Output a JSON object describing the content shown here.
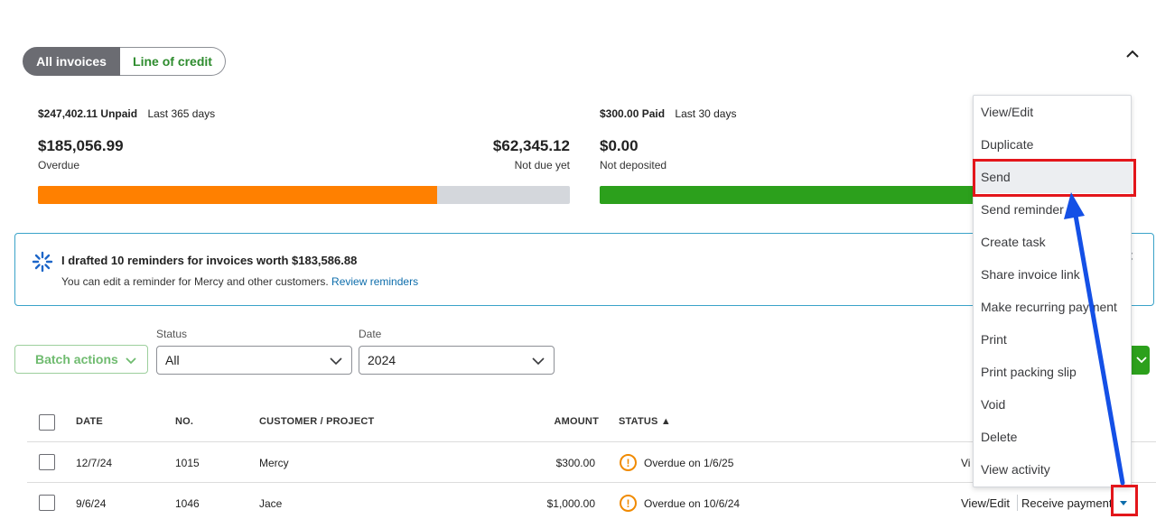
{
  "toggle": {
    "all_invoices": "All invoices",
    "line_of_credit": "Line of credit"
  },
  "unpaid": {
    "amount": "$247,402.11",
    "label": "Unpaid",
    "period": "Last 365 days",
    "overdue_amount": "$185,056.99",
    "overdue_label": "Overdue",
    "not_due_amount": "$62,345.12",
    "not_due_label": "Not due yet",
    "overdue_fraction": 0.75,
    "overdue_color": "#ff8000",
    "not_due_color": "#d4d7dc"
  },
  "paid": {
    "amount": "$300.00",
    "label": "Paid",
    "period": "Last 30 days",
    "not_deposited_amount": "$0.00",
    "not_deposited_label": "Not deposited",
    "bar_color": "#2ca01c"
  },
  "banner": {
    "title": "I drafted 10 reminders for invoices worth $183,586.88",
    "subtitle": "You can edit a reminder for Mercy and other customers.",
    "link": "Review reminders",
    "close_char": "×"
  },
  "filters": {
    "batch_actions": "Batch actions",
    "status_label": "Status",
    "status_value": "All",
    "date_label": "Date",
    "date_value": "2024"
  },
  "table": {
    "headers": {
      "date": "DATE",
      "no": "NO.",
      "customer": "CUSTOMER / PROJECT",
      "amount": "AMOUNT",
      "status": "STATUS ▲"
    },
    "rows": [
      {
        "date": "12/7/24",
        "no": "1015",
        "customer": "Mercy",
        "amount": "$300.00",
        "status": "Overdue on 1/6/25",
        "action": "Vi"
      },
      {
        "date": "9/6/24",
        "no": "1046",
        "customer": "Jace",
        "amount": "$1,000.00",
        "status": "Overdue on 10/6/24",
        "view_edit": "View/Edit",
        "receive_payment": "Receive payment"
      }
    ]
  },
  "menu": {
    "items": [
      "View/Edit",
      "Duplicate",
      "Send",
      "Send reminder",
      "Create task",
      "Share invoice link",
      "Make recurring payment",
      "Print",
      "Print packing slip",
      "Void",
      "Delete",
      "View activity"
    ],
    "highlighted": "Send"
  },
  "colors": {
    "annotation_red": "#e3161b",
    "annotation_arrow": "#1450e6",
    "link": "#0d6dab"
  }
}
